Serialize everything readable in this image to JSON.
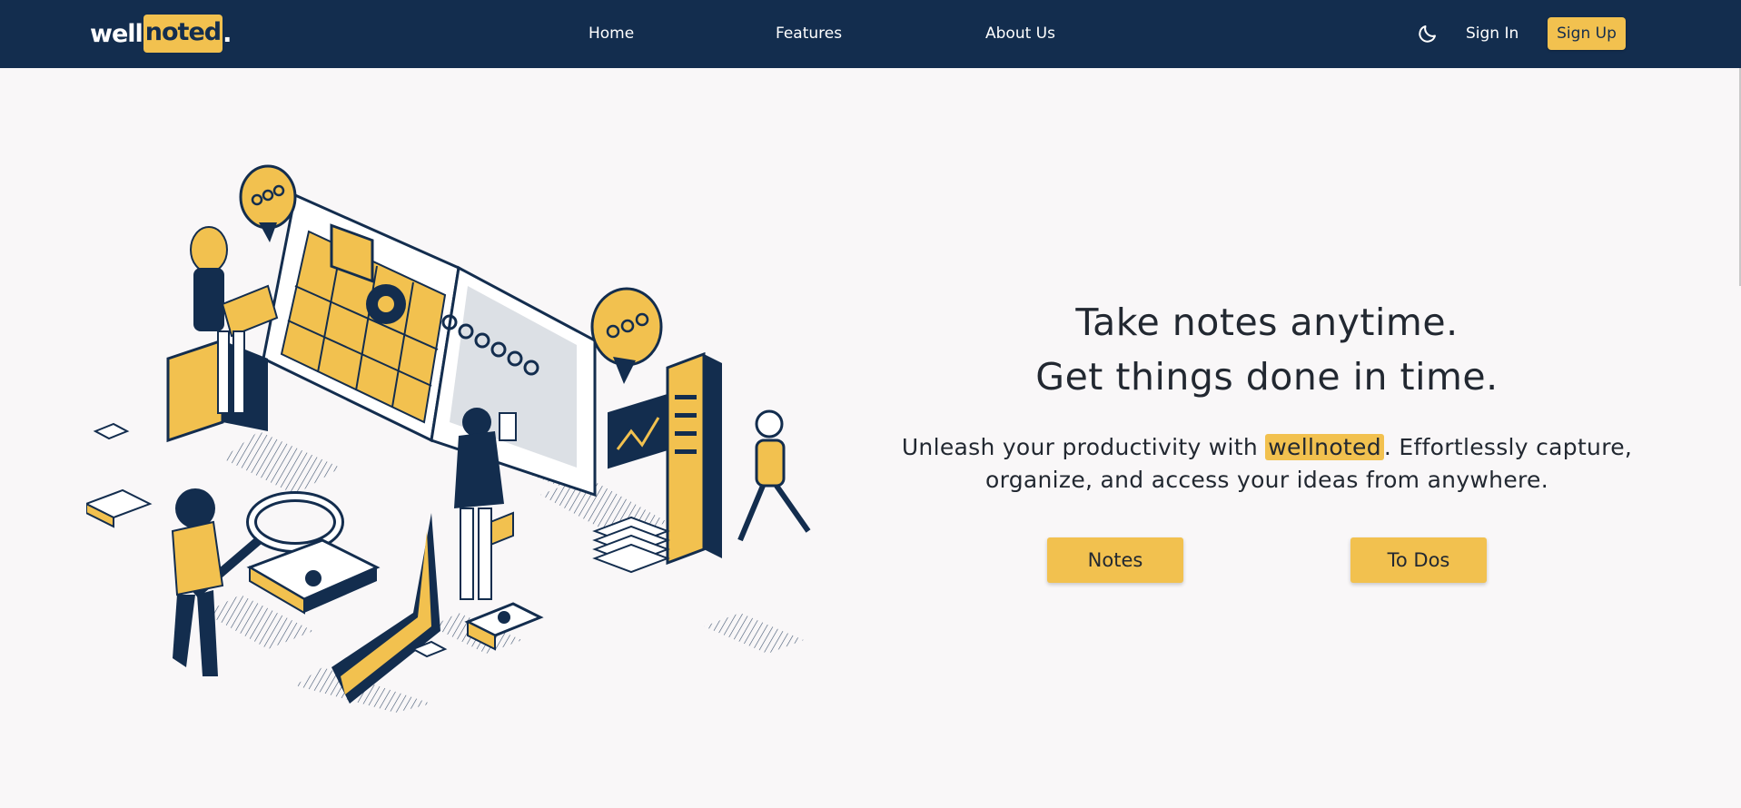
{
  "brand": {
    "part1": "well",
    "part2": "noted",
    "dot": "."
  },
  "nav": {
    "links": [
      "Home",
      "Features",
      "About Us"
    ],
    "theme_toggle_icon": "moon-icon",
    "sign_in": "Sign In",
    "sign_up": "Sign Up"
  },
  "hero": {
    "title_line1": "Take notes anytime.",
    "title_line2": "Get things done in time.",
    "subtitle_before": "Unleash your productivity with ",
    "subtitle_brand": "wellnoted",
    "subtitle_after": ". Effortlessly capture, organize, and access your ideas from anywhere.",
    "buttons": [
      "Notes",
      "To Dos"
    ]
  },
  "colors": {
    "nav_bg": "#132d4e",
    "accent": "#f2c14f",
    "page_bg": "#f9f7f8",
    "text": "#222831"
  }
}
